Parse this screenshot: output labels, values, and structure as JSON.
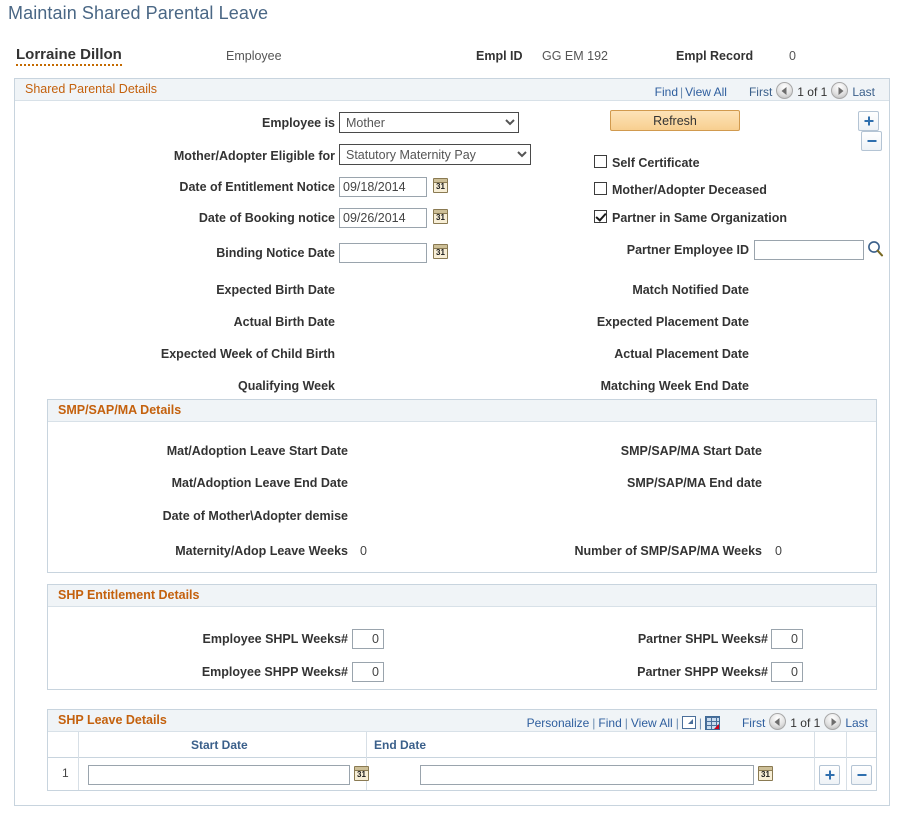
{
  "page": {
    "title": "Maintain Shared Parental Leave"
  },
  "employee_header": {
    "name": "Lorraine Dillon",
    "role": "Employee",
    "emplid_label": "Empl ID",
    "emplid_value": "GG EM 192",
    "emprecord_label": "Empl Record",
    "emprecord_value": "0"
  },
  "shared_parental_details": {
    "title": "Shared Parental Details",
    "nav": {
      "find": "Find",
      "view_all": "View All",
      "first": "First",
      "counter": "1 of 1",
      "last": "Last"
    },
    "refresh_label": "Refresh",
    "left_fields": [
      {
        "label": "Employee is",
        "value": "Mother",
        "type": "select"
      },
      {
        "label": "Mother/Adopter Eligible for",
        "value": "Statutory Maternity Pay",
        "type": "select"
      },
      {
        "label": "Date of Entitlement Notice",
        "value": "09/18/2014",
        "type": "date"
      },
      {
        "label": "Date of Booking notice",
        "value": "09/26/2014",
        "type": "date"
      },
      {
        "label": "Binding Notice Date",
        "value": "",
        "type": "date"
      },
      {
        "label": "Expected Birth Date",
        "value": "",
        "type": "static"
      },
      {
        "label": "Actual Birth Date",
        "value": "",
        "type": "static"
      },
      {
        "label": "Expected Week of Child Birth",
        "value": "",
        "type": "static"
      },
      {
        "label": "Qualifying Week",
        "value": "",
        "type": "static"
      }
    ],
    "checkboxes": [
      {
        "label": "Self Certificate",
        "checked": false
      },
      {
        "label": "Mother/Adopter Deceased",
        "checked": false
      },
      {
        "label": "Partner in Same Organization",
        "checked": true
      }
    ],
    "partner_employee_id": {
      "label": "Partner Employee ID",
      "value": ""
    },
    "right_fields": [
      {
        "label": "Match Notified Date",
        "value": ""
      },
      {
        "label": "Expected Placement Date",
        "value": ""
      },
      {
        "label": "Actual Placement Date",
        "value": ""
      },
      {
        "label": "Matching Week End Date",
        "value": ""
      }
    ],
    "select_options": {
      "employee_is": [
        "Mother"
      ],
      "eligible_for": [
        "Statutory Maternity Pay"
      ]
    }
  },
  "smp_sap_ma": {
    "title": "SMP/SAP/MA Details",
    "left_fields": [
      {
        "label": "Mat/Adoption Leave Start Date",
        "value": ""
      },
      {
        "label": "Mat/Adoption Leave End Date",
        "value": ""
      },
      {
        "label": "Date of Mother\\Adopter demise",
        "value": ""
      },
      {
        "label": "Maternity/Adop Leave Weeks",
        "value": "0"
      }
    ],
    "right_fields": [
      {
        "label": "SMP/SAP/MA Start Date",
        "value": ""
      },
      {
        "label": "SMP/SAP/MA End date",
        "value": ""
      },
      {
        "label": "Number of SMP/SAP/MA Weeks",
        "value": "0"
      }
    ]
  },
  "shp_entitlement": {
    "title": "SHP Entitlement Details",
    "fields": [
      {
        "label": "Employee SHPL Weeks#",
        "value": "0"
      },
      {
        "label": "Employee SHPP Weeks#",
        "value": "0"
      },
      {
        "label": "Partner SHPL Weeks#",
        "value": "0"
      },
      {
        "label": "Partner SHPP Weeks#",
        "value": "0"
      }
    ]
  },
  "shp_leave_details": {
    "title": "SHP Leave Details",
    "nav": {
      "personalize": "Personalize",
      "find": "Find",
      "view_all": "View All",
      "first": "First",
      "counter": "1 of 1",
      "last": "Last"
    },
    "columns": [
      "Start Date",
      "End Date"
    ],
    "rows": [
      {
        "num": "1",
        "start_date": "",
        "end_date": ""
      }
    ]
  },
  "icons": {
    "calendar": "31",
    "calendar_name": "calendar-icon",
    "lookup_name": "lookup-magnifier-icon",
    "expand_name": "new-window-icon",
    "grid_download_name": "download-to-spreadsheet-icon"
  },
  "colors": {
    "title_blue": "#4a6785",
    "section_orange": "#c4610d",
    "link_blue": "#2e5e9e",
    "refresh_bg": "#f8cf90",
    "group_header_bg": "#f0f4f7",
    "border": "#c8d4de"
  }
}
